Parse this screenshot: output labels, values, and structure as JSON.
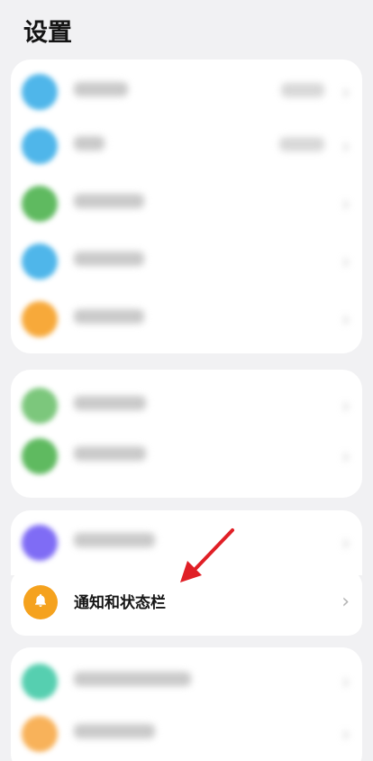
{
  "header": {
    "title": "设置"
  },
  "group1": {
    "items": [
      {
        "icon": "blurred-icon",
        "color": "#4fb6ea",
        "label": "",
        "value": "",
        "chevron": "›"
      },
      {
        "icon": "blurred-icon",
        "color": "#4fb6ea",
        "label": "",
        "value": "",
        "chevron": "›"
      },
      {
        "icon": "blurred-icon",
        "color": "#5fba60",
        "label": "",
        "value": "",
        "chevron": "›"
      },
      {
        "icon": "blurred-icon",
        "color": "#4fb6ea",
        "label": "",
        "value": "",
        "chevron": "›"
      },
      {
        "icon": "blurred-icon",
        "color": "#f7a93a",
        "label": "",
        "value": "",
        "chevron": "›"
      }
    ]
  },
  "group2": {
    "items": [
      {
        "icon": "blurred-icon",
        "color": "#7cc77c",
        "label": "",
        "chevron": "›"
      },
      {
        "icon": "blurred-icon",
        "color": "#5fba60",
        "label": "",
        "chevron": "›"
      }
    ]
  },
  "group3": {
    "items": [
      {
        "icon": "blurred-icon",
        "color": "#7f6cf5",
        "label": "",
        "chevron": "›"
      }
    ]
  },
  "highlighted_item": {
    "icon": "bell-icon",
    "color": "#f5a21e",
    "label": "通知和状态栏",
    "chevron": "›"
  },
  "group4": {
    "items": [
      {
        "icon": "blurred-icon",
        "color": "#56cfb0",
        "label": "",
        "chevron": "›"
      },
      {
        "icon": "blurred-icon",
        "color": "#f8b25a",
        "label": "",
        "chevron": "›"
      }
    ]
  },
  "annotation": {
    "arrow_color": "#e01f26"
  }
}
